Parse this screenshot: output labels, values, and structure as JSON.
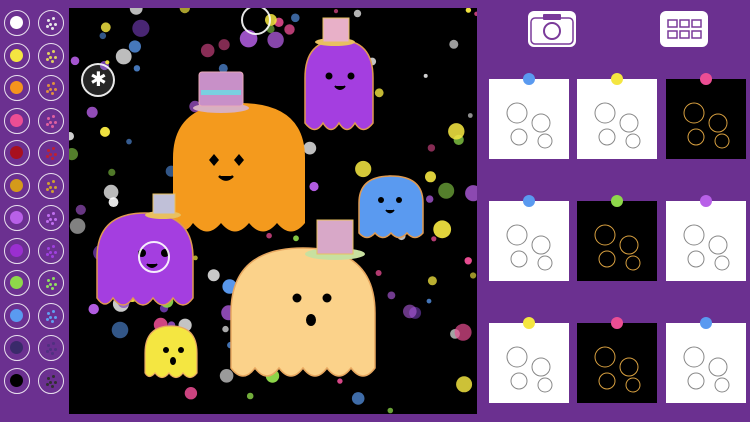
{
  "app": {
    "background": "#6b3090"
  },
  "palette": {
    "solid_colors": [
      "#ffffff",
      "#f4e641",
      "#f4941d",
      "#ec4e94",
      "#a8101e",
      "#d49a1a",
      "#b860e8",
      "#9a2fd0",
      "#8ed84a",
      "#5a9af0",
      "#3a2a6a",
      "#000000"
    ],
    "glitter_colors": [
      "#e8e8e8",
      "#e0d060",
      "#e09040",
      "#e060a0",
      "#c02030",
      "#d0a030",
      "#c070f0",
      "#a040e0",
      "#90e060",
      "#60a0f0",
      "#503080",
      "#303030"
    ]
  },
  "toolbar": {
    "camera_icon": "camera-icon",
    "gallery_icon": "grid-icon"
  },
  "gallery": {
    "thumbnails": [
      {
        "bg": "white",
        "pin": "#5a9af0",
        "motif": "pumpkin-ghosts"
      },
      {
        "bg": "white",
        "pin": "#f4e641",
        "motif": "pumpkins"
      },
      {
        "bg": "black",
        "pin": "#ec4e94",
        "motif": "ghosts"
      },
      {
        "bg": "white",
        "pin": "#5a9af0",
        "motif": "skull-chain"
      },
      {
        "bg": "black",
        "pin": "#8ed84a",
        "motif": "lantern-chain"
      },
      {
        "bg": "white",
        "pin": "#b860e8",
        "motif": "spiders"
      },
      {
        "bg": "white",
        "pin": "#f4e641",
        "motif": "tiles"
      },
      {
        "bg": "black",
        "pin": "#ec4e94",
        "motif": "cauldrons"
      },
      {
        "bg": "white",
        "pin": "#5a9af0",
        "motif": "skull-chain"
      }
    ]
  },
  "canvas": {
    "ghosts": [
      {
        "color": "#f49a1d",
        "name": "orange-ghost"
      },
      {
        "color": "#a43ee0",
        "name": "purple-ghost-top"
      },
      {
        "color": "#a43ee0",
        "name": "purple-ghost-left"
      },
      {
        "color": "#5a9af0",
        "name": "blue-ghost"
      },
      {
        "color": "#fbd28a",
        "name": "peach-ghost"
      },
      {
        "color": "#f4e641",
        "name": "yellow-ghost"
      }
    ]
  }
}
